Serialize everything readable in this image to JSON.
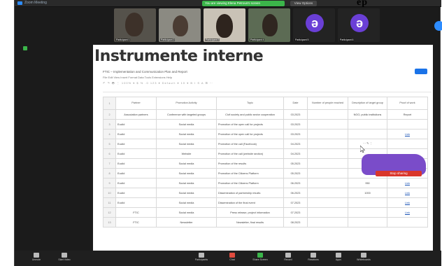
{
  "window": {
    "app_title": "Zoom Meeting",
    "top_caption": "ep"
  },
  "share_banner": {
    "text": "You are viewing Elena Petrova's screen",
    "stop_label": "View Options"
  },
  "participants": [
    {
      "name": "Participant 1"
    },
    {
      "name": "Participant 2"
    },
    {
      "name": "Participant 3"
    },
    {
      "name": "Participant 4"
    },
    {
      "name": "Participant 5",
      "avatar": "ə"
    },
    {
      "name": "Participant 6",
      "avatar": "ə"
    }
  ],
  "sheet": {
    "title": "Instrumente interne",
    "doc_name": "FTIC – Implementation and Communication Plan and Report",
    "menu": "File  Edit  View  Insert  Format  Data  Tools  Extensions  Help",
    "toolbar": "↶ ↷ 🖶 ⋮ 100% ▾  $ % .0 123 ▾  Default ▾  10 ▾  B I S A  ⊞ ⋯",
    "headers": [
      "Partner",
      "Promotion Activity",
      "Topic",
      "Date",
      "Number of people reached",
      "Description of target group",
      "Proof of work"
    ],
    "rows": [
      [
        "Association partners",
        "Conference with targeted groups",
        "Civil society and public sector cooperation",
        "03.2023",
        "",
        "NGO, public institutions",
        "Report"
      ],
      [
        "Euclid",
        "Social media",
        "Promotion of the open call for projects",
        "03.2023",
        "",
        "",
        ""
      ],
      [
        "Euclid",
        "Social media",
        "Promotion of the open call for projects",
        "03.2023",
        "",
        "",
        "Link"
      ],
      [
        "Euclid",
        "Social media",
        "Promotion of the call (Facebook)",
        "04.2023",
        "",
        "",
        ""
      ],
      [
        "Euclid",
        "Website",
        "Promotion of the call (website section)",
        "04.2023",
        "",
        "",
        ""
      ],
      [
        "Euclid",
        "Social media",
        "Promotion of the results",
        "05.2023",
        "",
        "220",
        "Link"
      ],
      [
        "Euclid",
        "Social media",
        "Promotion of the Citizens Platform",
        "05.2023",
        "",
        "900",
        "Link"
      ],
      [
        "Euclid",
        "Social media",
        "Promotion of the Citizens Platform",
        "06.2023",
        "",
        "950",
        "Link"
      ],
      [
        "Euclid",
        "Social media",
        "Dissemination of partnership results",
        "06.2023",
        "",
        "1000",
        "Link"
      ],
      [
        "Euclid",
        "Social media",
        "Dissemination of the final event",
        "07.2023",
        "",
        "",
        "Link"
      ],
      [
        "FTIC",
        "Social media",
        "Press release, project information",
        "07.2023",
        "",
        "",
        "Link"
      ],
      [
        "FTIC",
        "Newsletter",
        "Newsletter, final results",
        "08.2023",
        "",
        "",
        ""
      ]
    ],
    "row_numbers": [
      "1",
      "2",
      "3",
      "4",
      "5",
      "6",
      "7",
      "8",
      "9",
      "10",
      "11",
      "12",
      "13"
    ]
  },
  "popup": {
    "button_label": "Stop sharing"
  },
  "toolbar": {
    "items": [
      {
        "label": "Unmute",
        "icon": "microphone-icon"
      },
      {
        "label": "Start Video",
        "icon": "camera-icon"
      },
      {
        "label": "Participants",
        "icon": "participants-icon"
      },
      {
        "label": "Chat",
        "icon": "chat-icon"
      },
      {
        "label": "Share Screen",
        "icon": "share-screen-icon"
      },
      {
        "label": "Record",
        "icon": "record-icon"
      },
      {
        "label": "Reactions",
        "icon": "reactions-icon"
      },
      {
        "label": "Apps",
        "icon": "apps-icon"
      },
      {
        "label": "Whiteboards",
        "icon": "whiteboard-icon"
      }
    ],
    "end_label": "End"
  },
  "colors": {
    "zoom_blue": "#2d8cff",
    "share_green": "#3bb54a",
    "avatar_purple": "#6a3fd6",
    "stop_red": "#d9362b"
  }
}
